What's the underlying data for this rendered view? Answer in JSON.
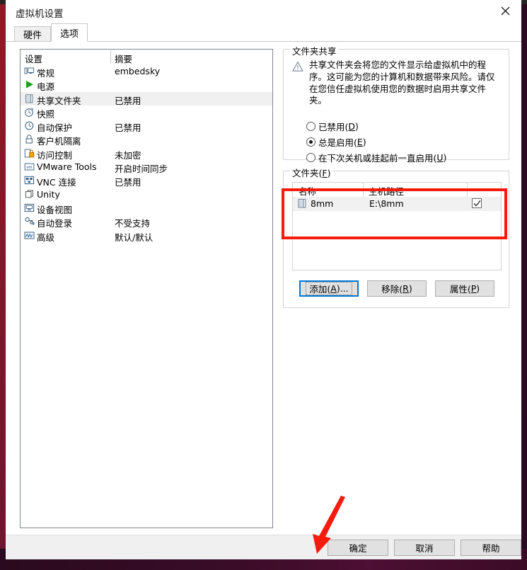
{
  "window": {
    "title": "虚拟机设置",
    "close_label": "×"
  },
  "tabs": [
    {
      "label": "硬件",
      "active": false
    },
    {
      "label": "选项",
      "active": true
    }
  ],
  "settings_list": {
    "headers": {
      "setting": "设置",
      "summary": "摘要"
    },
    "rows": [
      {
        "icon": "monitor-icon",
        "label": "常规",
        "summary": "embedsky",
        "selected": false
      },
      {
        "icon": "power-play-icon",
        "label": "电源",
        "summary": "",
        "selected": false
      },
      {
        "icon": "shared-folder-icon",
        "label": "共享文件夹",
        "summary": "已禁用",
        "selected": true
      },
      {
        "icon": "snapshot-clock-icon",
        "label": "快照",
        "summary": "",
        "selected": false
      },
      {
        "icon": "autoprotect-icon",
        "label": "自动保护",
        "summary": "已禁用",
        "selected": false
      },
      {
        "icon": "lock-icon",
        "label": "客户机隔离",
        "summary": "",
        "selected": false
      },
      {
        "icon": "access-control-icon",
        "label": "访问控制",
        "summary": "未加密",
        "selected": false
      },
      {
        "icon": "vmware-tools-icon",
        "label": "VMware Tools",
        "summary": "开启时间同步",
        "selected": false
      },
      {
        "icon": "vnc-icon",
        "label": "VNC 连接",
        "summary": "已禁用",
        "selected": false
      },
      {
        "icon": "unity-icon",
        "label": "Unity",
        "summary": "",
        "selected": false
      },
      {
        "icon": "device-view-icon",
        "label": "设备视图",
        "summary": "",
        "selected": false
      },
      {
        "icon": "autologin-icon",
        "label": "自动登录",
        "summary": "不受支持",
        "selected": false
      },
      {
        "icon": "advanced-icon",
        "label": "高级",
        "summary": "默认/默认",
        "selected": false
      }
    ]
  },
  "folder_sharing": {
    "legend": "文件夹共享",
    "warning_icon": "warning-triangle-icon",
    "warning_text": "共享文件夹会将您的文件显示给虚拟机中的程序。这可能为您的计算机和数据带来风险。请仅在您信任虚拟机使用您的数据时启用共享文件夹。",
    "options": [
      {
        "label": "已禁用(",
        "mnemonic": "D",
        "suffix": ")",
        "checked": false
      },
      {
        "label": "总是启用(",
        "mnemonic": "E",
        "suffix": ")",
        "checked": true
      },
      {
        "label": "在下次关机或挂起前一直启用(",
        "mnemonic": "U",
        "suffix": ")",
        "checked": false
      }
    ]
  },
  "folders": {
    "legend_prefix": "文件夹(",
    "legend_mnemonic": "F",
    "legend_suffix": ")",
    "columns": {
      "name": "名称",
      "host_path": "主机路径"
    },
    "rows": [
      {
        "icon": "folder-icon",
        "name": "8mm",
        "host_path": "E:\\8mm",
        "enabled": true,
        "selected": true
      }
    ],
    "buttons": [
      {
        "id": "add",
        "prefix": "添加(",
        "mnemonic": "A",
        "suffix": ")...",
        "focused": true
      },
      {
        "id": "remove",
        "prefix": "移除(",
        "mnemonic": "R",
        "suffix": ")",
        "focused": false
      },
      {
        "id": "properties",
        "prefix": "属性(",
        "mnemonic": "P",
        "suffix": ")",
        "focused": false
      }
    ]
  },
  "dialog_buttons": [
    {
      "id": "ok",
      "label": "确定"
    },
    {
      "id": "cancel",
      "label": "取消"
    },
    {
      "id": "help",
      "label": "帮助"
    }
  ],
  "annotations": {
    "highlight_color": "#f51b0d",
    "arrow_color": "#f51b0d",
    "highlight_target": "folders-table-row",
    "arrow_target": "ok-button"
  }
}
